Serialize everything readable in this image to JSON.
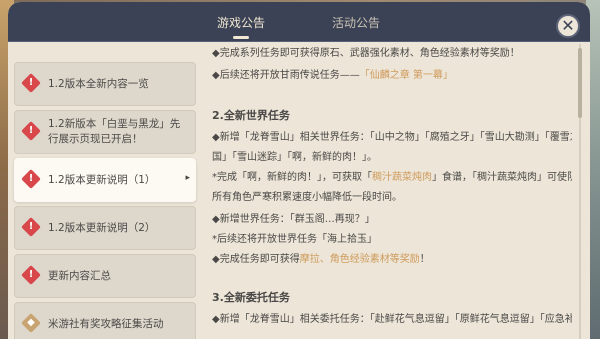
{
  "tabs": {
    "game": "游戏公告",
    "activity": "活动公告"
  },
  "close_label": "✕",
  "sidebar": {
    "items": [
      {
        "label": "1.2版本全新内容一览",
        "badge": "!"
      },
      {
        "label": "1.2新版本「白垩与黑龙」先行展示页现已开启！",
        "badge": "!"
      },
      {
        "label": "1.2版本更新说明（1）",
        "badge": "!",
        "arrow": "▸"
      },
      {
        "label": "1.2版本更新说明（2）",
        "badge": "!"
      },
      {
        "label": "更新内容汇总",
        "badge": "!"
      },
      {
        "label": "米游社有奖攻略征集活动",
        "badge": "◆"
      }
    ]
  },
  "content": {
    "l1": "◆完成系列任务即可获得原石、武器强化素材、角色经验素材等奖励！",
    "l2a": "◆后续还将开放甘雨传说任务——",
    "l2b": "「仙麟之章 第一幕」",
    "h2": "2.全新世界任务",
    "l3": "◆新增「龙脊雪山」相关世界任务：「山中之物」「腐殖之牙」「雪山大勘测」「覆雪之",
    "l4": "国」「雪山迷踪」「啊，新鲜的肉！」。",
    "l5a": "*完成「啊，新鲜的肉！」，可获取「",
    "l5b": "稠汁蔬菜炖肉",
    "l5c": "」食谱，「稠汁蔬菜炖肉」可使队伍中",
    "l6": "所有角色严寒积累速度小幅降低一段时间。",
    "l7": "◆新增世界任务：「群玉阁…再现？」",
    "l8": "*后续还将开放世界任务「海上拾玉」",
    "l9a": "◆完成任务即可获得",
    "l9b": "摩拉、角色经验素材等奖励",
    "l9c": "！",
    "h3": "3.全新委托任务",
    "l10": "◆新增「龙脊雪山」相关委托任务：「赴鲜花气息逗留」「原鲜花气息逗留」「应急补"
  },
  "colors": {
    "header": "#3b4255",
    "panel": "#ece5d8",
    "highlight": "#cf9a5a",
    "badge": "#d8484b"
  }
}
